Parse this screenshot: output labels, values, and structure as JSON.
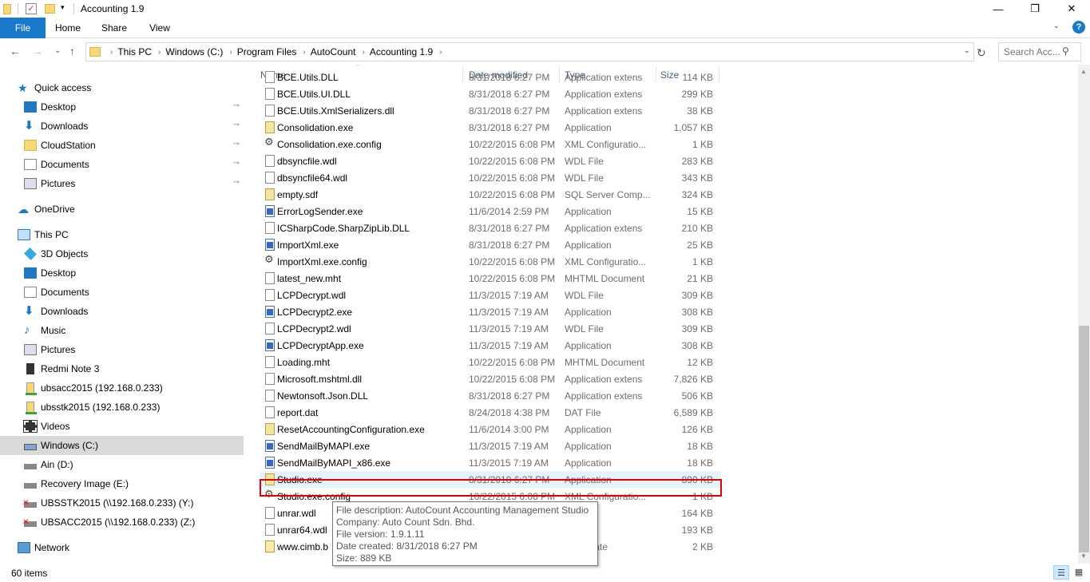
{
  "window": {
    "title": "Accounting 1.9",
    "minimize": "—",
    "maximize": "❐",
    "close": "✕"
  },
  "ribbon": {
    "tabs": [
      "File",
      "Home",
      "Share",
      "View"
    ],
    "expand": "⌄",
    "help": "?"
  },
  "nav": {
    "back": "←",
    "forward": "→",
    "recent": "⌄",
    "up": "↑",
    "refresh": "↻"
  },
  "address": {
    "crumbs": [
      "This PC",
      "Windows (C:)",
      "Program Files",
      "AutoCount",
      "Accounting 1.9"
    ],
    "separator": "›",
    "dropdown": "⌄"
  },
  "search": {
    "placeholder": "Search Acc..."
  },
  "sidebar": {
    "items": [
      {
        "label": "Quick access",
        "icon": "star-icon"
      },
      {
        "label": "Desktop",
        "icon": "desktop-icon",
        "pinned": true
      },
      {
        "label": "Downloads",
        "icon": "download-icon",
        "pinned": true
      },
      {
        "label": "CloudStation",
        "icon": "folder-icon",
        "pinned": true
      },
      {
        "label": "Documents",
        "icon": "document-icon",
        "pinned": true
      },
      {
        "label": "Pictures",
        "icon": "pictures-icon",
        "pinned": true
      },
      {
        "label": "OneDrive",
        "icon": "cloud-icon"
      },
      {
        "label": "This PC",
        "icon": "computer-icon"
      },
      {
        "label": "3D Objects",
        "icon": "cube-icon"
      },
      {
        "label": "Desktop",
        "icon": "desktop-icon"
      },
      {
        "label": "Documents",
        "icon": "document-icon"
      },
      {
        "label": "Downloads",
        "icon": "download-icon"
      },
      {
        "label": "Music",
        "icon": "music-icon"
      },
      {
        "label": "Pictures",
        "icon": "pictures-icon"
      },
      {
        "label": "Redmi Note 3",
        "icon": "phone-icon"
      },
      {
        "label": "ubsacc2015 (192.168.0.233)",
        "icon": "network-share-icon"
      },
      {
        "label": "ubsstk2015 (192.168.0.233)",
        "icon": "network-share-icon"
      },
      {
        "label": "Videos",
        "icon": "video-icon"
      },
      {
        "label": "Windows (C:)",
        "icon": "system-drive-icon",
        "selected": true
      },
      {
        "label": "Ain (D:)",
        "icon": "drive-icon"
      },
      {
        "label": "Recovery Image (E:)",
        "icon": "drive-icon"
      },
      {
        "label": "UBSSTK2015 (\\\\192.168.0.233) (Y:)",
        "icon": "disconnected-drive-icon"
      },
      {
        "label": "UBSACC2015 (\\\\192.168.0.233) (Z:)",
        "icon": "disconnected-drive-icon"
      },
      {
        "label": "Network",
        "icon": "network-icon"
      }
    ],
    "pin_glyph": "📌"
  },
  "columns": {
    "name": "Name",
    "date": "Date modified",
    "type": "Type",
    "size": "Size",
    "sort_indicator": "^"
  },
  "files": [
    {
      "name": "BCE.Utils.DLL",
      "date": "8/31/2018 6:27 PM",
      "type": "Application extens",
      "size": "114 KB",
      "kind": "doc"
    },
    {
      "name": "BCE.Utils.UI.DLL",
      "date": "8/31/2018 6:27 PM",
      "type": "Application extens",
      "size": "299 KB",
      "kind": "doc"
    },
    {
      "name": "BCE.Utils.XmlSerializers.dll",
      "date": "8/31/2018 6:27 PM",
      "type": "Application extens",
      "size": "38 KB",
      "kind": "doc"
    },
    {
      "name": "Consolidation.exe",
      "date": "8/31/2018 6:27 PM",
      "type": "Application",
      "size": "1,057 KB",
      "kind": "setup"
    },
    {
      "name": "Consolidation.exe.config",
      "date": "10/22/2015 6:08 PM",
      "type": "XML Configuratio...",
      "size": "1 KB",
      "kind": "cfg"
    },
    {
      "name": "dbsyncfile.wdl",
      "date": "10/22/2015 6:08 PM",
      "type": "WDL File",
      "size": "283 KB",
      "kind": "doc"
    },
    {
      "name": "dbsyncfile64.wdl",
      "date": "10/22/2015 6:08 PM",
      "type": "WDL File",
      "size": "343 KB",
      "kind": "doc"
    },
    {
      "name": "empty.sdf",
      "date": "10/22/2015 6:08 PM",
      "type": "SQL Server Comp...",
      "size": "324 KB",
      "kind": "setup"
    },
    {
      "name": "ErrorLogSender.exe",
      "date": "11/6/2014 2:59 PM",
      "type": "Application",
      "size": "15 KB",
      "kind": "app"
    },
    {
      "name": "ICSharpCode.SharpZipLib.DLL",
      "date": "8/31/2018 6:27 PM",
      "type": "Application extens",
      "size": "210 KB",
      "kind": "doc"
    },
    {
      "name": "ImportXml.exe",
      "date": "8/31/2018 6:27 PM",
      "type": "Application",
      "size": "25 KB",
      "kind": "app"
    },
    {
      "name": "ImportXml.exe.config",
      "date": "10/22/2015 6:08 PM",
      "type": "XML Configuratio...",
      "size": "1 KB",
      "kind": "cfg"
    },
    {
      "name": "latest_new.mht",
      "date": "10/22/2015 6:08 PM",
      "type": "MHTML Document",
      "size": "21 KB",
      "kind": "doc"
    },
    {
      "name": "LCPDecrypt.wdl",
      "date": "11/3/2015 7:19 AM",
      "type": "WDL File",
      "size": "309 KB",
      "kind": "doc"
    },
    {
      "name": "LCPDecrypt2.exe",
      "date": "11/3/2015 7:19 AM",
      "type": "Application",
      "size": "308 KB",
      "kind": "app"
    },
    {
      "name": "LCPDecrypt2.wdl",
      "date": "11/3/2015 7:19 AM",
      "type": "WDL File",
      "size": "309 KB",
      "kind": "doc"
    },
    {
      "name": "LCPDecryptApp.exe",
      "date": "11/3/2015 7:19 AM",
      "type": "Application",
      "size": "308 KB",
      "kind": "app"
    },
    {
      "name": "Loading.mht",
      "date": "10/22/2015 6:08 PM",
      "type": "MHTML Document",
      "size": "12 KB",
      "kind": "doc"
    },
    {
      "name": "Microsoft.mshtml.dll",
      "date": "10/22/2015 6:08 PM",
      "type": "Application extens",
      "size": "7,826 KB",
      "kind": "doc"
    },
    {
      "name": "Newtonsoft.Json.DLL",
      "date": "8/31/2018 6:27 PM",
      "type": "Application extens",
      "size": "506 KB",
      "kind": "doc"
    },
    {
      "name": "report.dat",
      "date": "8/24/2018 4:38 PM",
      "type": "DAT File",
      "size": "6,589 KB",
      "kind": "doc"
    },
    {
      "name": "ResetAccountingConfiguration.exe",
      "date": "11/6/2014 3:00 PM",
      "type": "Application",
      "size": "126 KB",
      "kind": "setup"
    },
    {
      "name": "SendMailByMAPI.exe",
      "date": "11/3/2015 7:19 AM",
      "type": "Application",
      "size": "18 KB",
      "kind": "app"
    },
    {
      "name": "SendMailByMAPI_x86.exe",
      "date": "11/3/2015 7:19 AM",
      "type": "Application",
      "size": "18 KB",
      "kind": "app"
    },
    {
      "name": "Studio.exe",
      "date": "8/31/2018 6:27 PM",
      "type": "Application",
      "size": "890 KB",
      "kind": "setup",
      "highlighted": true
    },
    {
      "name": "Studio.exe.config",
      "date": "10/22/2015 6:08 PM",
      "type": "XML Configuratio...",
      "size": "1 KB",
      "kind": "cfg"
    },
    {
      "name": "unrar.wdl",
      "date": "",
      "type": "",
      "size": "164 KB",
      "kind": "doc"
    },
    {
      "name": "unrar64.wdl",
      "date": "",
      "type": "",
      "size": "193 KB",
      "kind": "doc"
    },
    {
      "name": "www.cimb.b",
      "date": "",
      "type": "Certificate",
      "size": "2 KB",
      "kind": "cert"
    }
  ],
  "tooltip": {
    "lines": [
      "File description: AutoCount Accounting Management Studio",
      "Company: Auto Count Sdn. Bhd.",
      "File version: 1.9.1.11",
      "Date created: 8/31/2018 6:27 PM",
      "Size: 889 KB"
    ]
  },
  "scrollbar": {
    "up": "▲",
    "down": "▼"
  },
  "status": {
    "item_count": "60 items",
    "details_view": "☰",
    "icons_view": "▦"
  }
}
